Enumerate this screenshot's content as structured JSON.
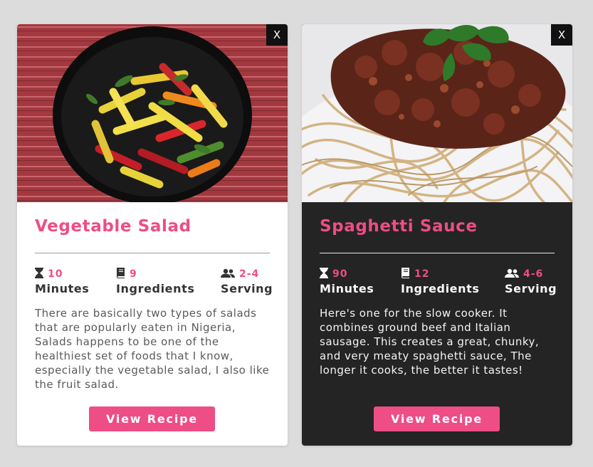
{
  "cards": [
    {
      "close_label": "X",
      "title": "Vegetable Salad",
      "stats": [
        {
          "icon": "hourglass-icon",
          "value": "10",
          "label": "Minutes"
        },
        {
          "icon": "book-icon",
          "value": "9",
          "label": "Ingredients"
        },
        {
          "icon": "users-icon",
          "value": "2-4",
          "label": "Serving"
        }
      ],
      "description": "There are basically two types of salads that are popularly eaten in Nigeria, Salads happens to be one of the healthiest set of foods that I know, especially the vegetable salad, I also like the fruit salad.",
      "button_label": "View Recipe"
    },
    {
      "close_label": "X",
      "title": "Spaghetti Sauce",
      "stats": [
        {
          "icon": "hourglass-icon",
          "value": "90",
          "label": "Minutes"
        },
        {
          "icon": "book-icon",
          "value": "12",
          "label": "Ingredients"
        },
        {
          "icon": "users-icon",
          "value": "4-6",
          "label": "Serving"
        }
      ],
      "description": "Here's one for the slow cooker. It combines ground beef and Italian sausage. This creates a great, chunky, and very meaty spaghetti sauce, The longer it cooks, the better it tastes!",
      "button_label": "View Recipe"
    }
  ],
  "colors": {
    "accent": "#ee4d86",
    "dark_card": "#242424",
    "light_card": "#ffffff",
    "page_background": "#dcdcdc"
  }
}
